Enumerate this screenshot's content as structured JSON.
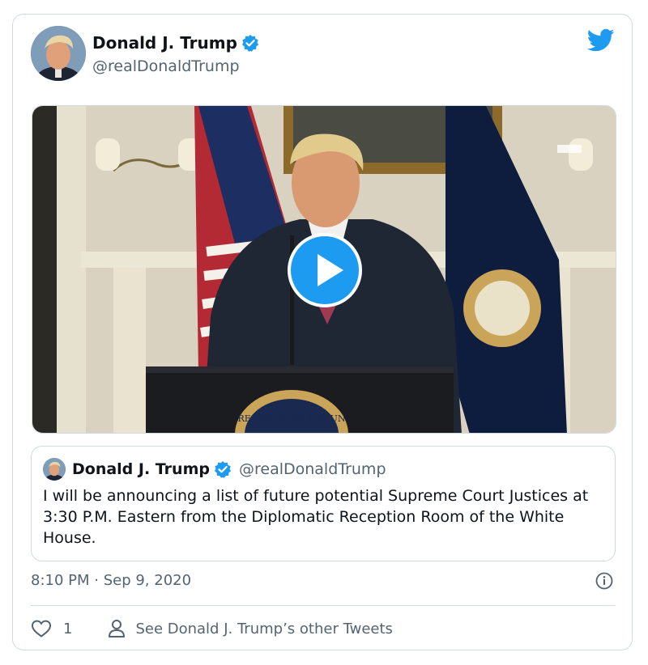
{
  "author": {
    "name": "Donald J. Trump",
    "handle": "@realDonaldTrump"
  },
  "quoted_tweet": {
    "name": "Donald J. Trump",
    "handle": "@realDonaldTrump",
    "text": "I will be announcing a list of future potential Supreme Court Justices at 3:30 P.M. Eastern from the Diplomatic Reception Room of the White House."
  },
  "video": {
    "seal_text": "RESIDENT OF THE UN"
  },
  "timestamp": "8:10 PM · Sep 9, 2020",
  "actions": {
    "like_count": "1",
    "other_tweets_label": "See Donald J. Trump’s other Tweets"
  },
  "icons": {
    "verified": "verified-badge-icon",
    "brand": "twitter-bird-icon",
    "play": "play-icon",
    "info": "info-icon",
    "like": "heart-icon",
    "profile": "person-icon"
  },
  "colors": {
    "accent": "#1d9bf0",
    "secondary_text": "#536471",
    "border": "#cfd9de",
    "primary_text": "#0f1419"
  }
}
